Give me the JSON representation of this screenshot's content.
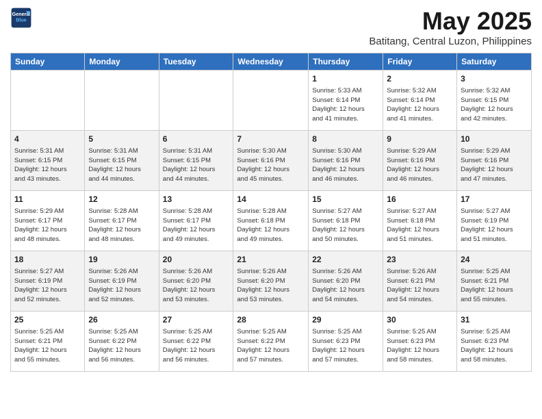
{
  "header": {
    "logo_line1": "General",
    "logo_line2": "Blue",
    "title": "May 2025",
    "subtitle": "Batitang, Central Luzon, Philippines"
  },
  "days_of_week": [
    "Sunday",
    "Monday",
    "Tuesday",
    "Wednesday",
    "Thursday",
    "Friday",
    "Saturday"
  ],
  "weeks": [
    [
      {
        "num": "",
        "info": ""
      },
      {
        "num": "",
        "info": ""
      },
      {
        "num": "",
        "info": ""
      },
      {
        "num": "",
        "info": ""
      },
      {
        "num": "1",
        "info": "Sunrise: 5:33 AM\nSunset: 6:14 PM\nDaylight: 12 hours\nand 41 minutes."
      },
      {
        "num": "2",
        "info": "Sunrise: 5:32 AM\nSunset: 6:14 PM\nDaylight: 12 hours\nand 41 minutes."
      },
      {
        "num": "3",
        "info": "Sunrise: 5:32 AM\nSunset: 6:15 PM\nDaylight: 12 hours\nand 42 minutes."
      }
    ],
    [
      {
        "num": "4",
        "info": "Sunrise: 5:31 AM\nSunset: 6:15 PM\nDaylight: 12 hours\nand 43 minutes."
      },
      {
        "num": "5",
        "info": "Sunrise: 5:31 AM\nSunset: 6:15 PM\nDaylight: 12 hours\nand 44 minutes."
      },
      {
        "num": "6",
        "info": "Sunrise: 5:31 AM\nSunset: 6:15 PM\nDaylight: 12 hours\nand 44 minutes."
      },
      {
        "num": "7",
        "info": "Sunrise: 5:30 AM\nSunset: 6:16 PM\nDaylight: 12 hours\nand 45 minutes."
      },
      {
        "num": "8",
        "info": "Sunrise: 5:30 AM\nSunset: 6:16 PM\nDaylight: 12 hours\nand 46 minutes."
      },
      {
        "num": "9",
        "info": "Sunrise: 5:29 AM\nSunset: 6:16 PM\nDaylight: 12 hours\nand 46 minutes."
      },
      {
        "num": "10",
        "info": "Sunrise: 5:29 AM\nSunset: 6:16 PM\nDaylight: 12 hours\nand 47 minutes."
      }
    ],
    [
      {
        "num": "11",
        "info": "Sunrise: 5:29 AM\nSunset: 6:17 PM\nDaylight: 12 hours\nand 48 minutes."
      },
      {
        "num": "12",
        "info": "Sunrise: 5:28 AM\nSunset: 6:17 PM\nDaylight: 12 hours\nand 48 minutes."
      },
      {
        "num": "13",
        "info": "Sunrise: 5:28 AM\nSunset: 6:17 PM\nDaylight: 12 hours\nand 49 minutes."
      },
      {
        "num": "14",
        "info": "Sunrise: 5:28 AM\nSunset: 6:18 PM\nDaylight: 12 hours\nand 49 minutes."
      },
      {
        "num": "15",
        "info": "Sunrise: 5:27 AM\nSunset: 6:18 PM\nDaylight: 12 hours\nand 50 minutes."
      },
      {
        "num": "16",
        "info": "Sunrise: 5:27 AM\nSunset: 6:18 PM\nDaylight: 12 hours\nand 51 minutes."
      },
      {
        "num": "17",
        "info": "Sunrise: 5:27 AM\nSunset: 6:19 PM\nDaylight: 12 hours\nand 51 minutes."
      }
    ],
    [
      {
        "num": "18",
        "info": "Sunrise: 5:27 AM\nSunset: 6:19 PM\nDaylight: 12 hours\nand 52 minutes."
      },
      {
        "num": "19",
        "info": "Sunrise: 5:26 AM\nSunset: 6:19 PM\nDaylight: 12 hours\nand 52 minutes."
      },
      {
        "num": "20",
        "info": "Sunrise: 5:26 AM\nSunset: 6:20 PM\nDaylight: 12 hours\nand 53 minutes."
      },
      {
        "num": "21",
        "info": "Sunrise: 5:26 AM\nSunset: 6:20 PM\nDaylight: 12 hours\nand 53 minutes."
      },
      {
        "num": "22",
        "info": "Sunrise: 5:26 AM\nSunset: 6:20 PM\nDaylight: 12 hours\nand 54 minutes."
      },
      {
        "num": "23",
        "info": "Sunrise: 5:26 AM\nSunset: 6:21 PM\nDaylight: 12 hours\nand 54 minutes."
      },
      {
        "num": "24",
        "info": "Sunrise: 5:25 AM\nSunset: 6:21 PM\nDaylight: 12 hours\nand 55 minutes."
      }
    ],
    [
      {
        "num": "25",
        "info": "Sunrise: 5:25 AM\nSunset: 6:21 PM\nDaylight: 12 hours\nand 55 minutes."
      },
      {
        "num": "26",
        "info": "Sunrise: 5:25 AM\nSunset: 6:22 PM\nDaylight: 12 hours\nand 56 minutes."
      },
      {
        "num": "27",
        "info": "Sunrise: 5:25 AM\nSunset: 6:22 PM\nDaylight: 12 hours\nand 56 minutes."
      },
      {
        "num": "28",
        "info": "Sunrise: 5:25 AM\nSunset: 6:22 PM\nDaylight: 12 hours\nand 57 minutes."
      },
      {
        "num": "29",
        "info": "Sunrise: 5:25 AM\nSunset: 6:23 PM\nDaylight: 12 hours\nand 57 minutes."
      },
      {
        "num": "30",
        "info": "Sunrise: 5:25 AM\nSunset: 6:23 PM\nDaylight: 12 hours\nand 58 minutes."
      },
      {
        "num": "31",
        "info": "Sunrise: 5:25 AM\nSunset: 6:23 PM\nDaylight: 12 hours\nand 58 minutes."
      }
    ]
  ]
}
